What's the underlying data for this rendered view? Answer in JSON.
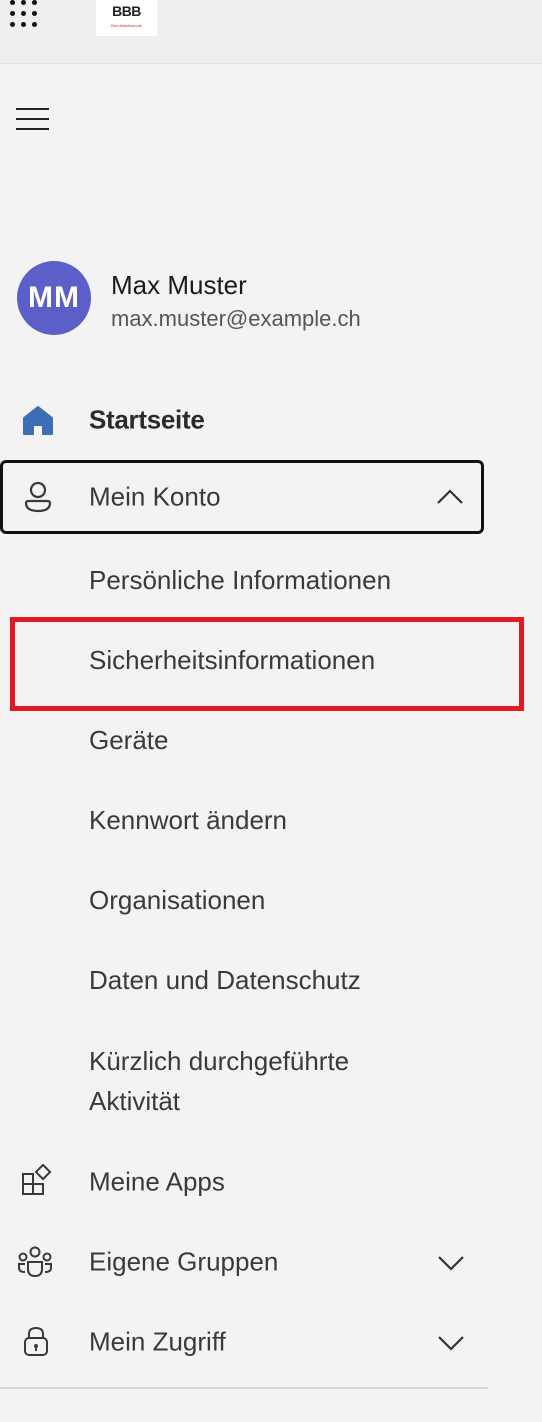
{
  "header": {
    "logo_main": "BBB",
    "logo_sub": "Berufsfachschule"
  },
  "user": {
    "initials": "MM",
    "name": "Max Muster",
    "email": "max.muster@example.ch"
  },
  "nav": {
    "home": "Startseite",
    "my_account": {
      "label": "Mein Konto",
      "expanded": true,
      "items": [
        "Persönliche Informationen",
        "Sicherheitsinformationen",
        "Geräte",
        "Kennwort ändern",
        "Organisationen",
        "Daten und Datenschutz",
        "Kürzlich durchgeführte Aktivität"
      ]
    },
    "my_apps": "Meine Apps",
    "groups": "Eigene Gruppen",
    "access": "Mein Zugriff"
  },
  "colors": {
    "background": "#f3f3f3",
    "avatar": "#5b5fc7",
    "home_icon": "#3d6eb4",
    "highlight": "#e01b22"
  }
}
